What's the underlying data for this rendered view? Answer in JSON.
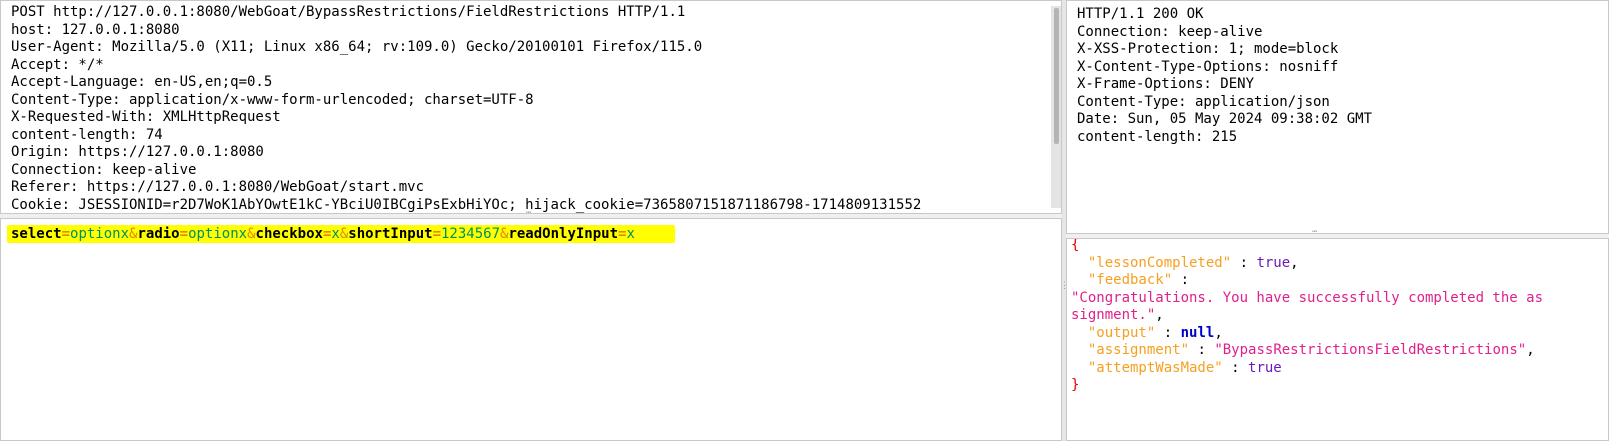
{
  "request": {
    "headers": [
      "POST http://127.0.0.1:8080/WebGoat/BypassRestrictions/FieldRestrictions HTTP/1.1",
      "host: 127.0.0.1:8080",
      "User-Agent: Mozilla/5.0 (X11; Linux x86_64; rv:109.0) Gecko/20100101 Firefox/115.0",
      "Accept: */*",
      "Accept-Language: en-US,en;q=0.5",
      "Content-Type: application/x-www-form-urlencoded; charset=UTF-8",
      "X-Requested-With: XMLHttpRequest",
      "content-length: 74",
      "Origin: https://127.0.0.1:8080",
      "Connection: keep-alive",
      "Referer: https://127.0.0.1:8080/WebGoat/start.mvc",
      "Cookie: JSESSIONID=r2D7WoK1AbYOwtE1kC-YBciU0IBCgiPsExbHiYOc; hijack_cookie=7365807151871186798-1714809131552"
    ],
    "body_params": [
      {
        "key": "select",
        "value": "optionx"
      },
      {
        "key": "radio",
        "value": "optionx"
      },
      {
        "key": "checkbox",
        "value": "x"
      },
      {
        "key": "shortInput",
        "value": "1234567"
      },
      {
        "key": "readOnlyInput",
        "value": "x"
      }
    ],
    "body_symbols": {
      "eq": "=",
      "amp": "&"
    }
  },
  "response": {
    "headers": [
      "HTTP/1.1 200 OK",
      "Connection: keep-alive",
      "X-XSS-Protection: 1; mode=block",
      "X-Content-Type-Options: nosniff",
      "X-Frame-Options: DENY",
      "Content-Type: application/json",
      "Date: Sun, 05 May 2024 09:38:02 GMT",
      "content-length: 215"
    ],
    "json": {
      "open": "{",
      "close": "}",
      "colon": " : ",
      "comma": ",",
      "lessonCompleted_key": "\"lessonCompleted\"",
      "lessonCompleted_val": "true",
      "feedback_key": "\"feedback\"",
      "feedback_val_line1": "\"Congratulations. You have successfully completed the as",
      "feedback_val_line2": "signment.\"",
      "output_key": "\"output\"",
      "output_val": "null",
      "assignment_key": "\"assignment\"",
      "assignment_val": "\"BypassRestrictionsFieldRestrictions\"",
      "attemptWasMade_key": "\"attemptWasMade\"",
      "attemptWasMade_val": "true"
    }
  },
  "ui": {
    "grip_h": "⋯",
    "grip_v": "⋮"
  }
}
